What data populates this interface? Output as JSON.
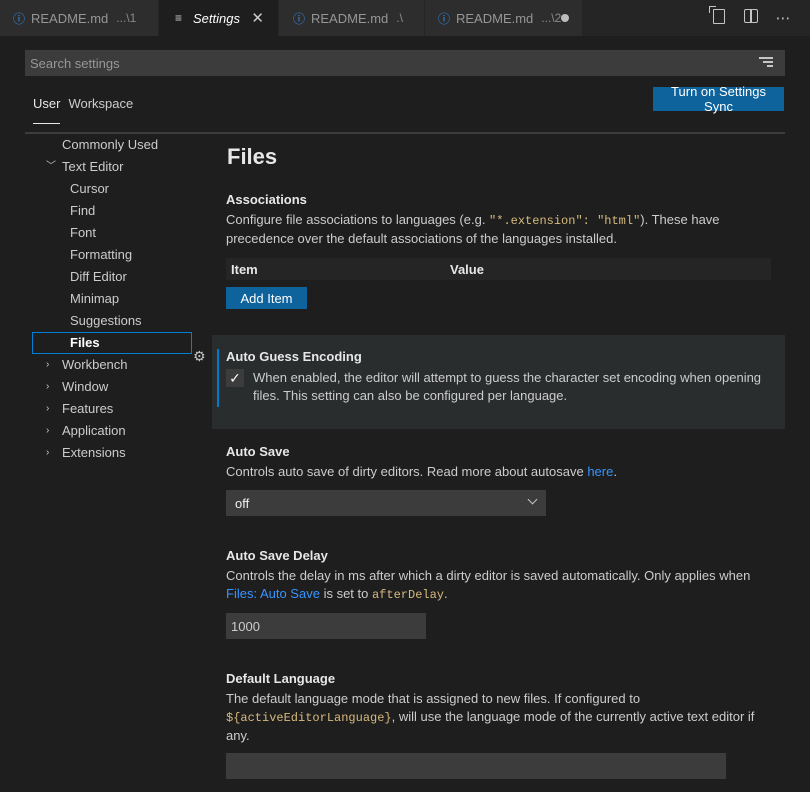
{
  "tabs": [
    {
      "label": "README.md",
      "description": "...\\1",
      "icon": "info-icon"
    },
    {
      "label": "Settings",
      "icon": "menu-icon",
      "close": "✕"
    },
    {
      "label": "README.md",
      "description": ".\\",
      "icon": "info-icon"
    },
    {
      "label": "README.md",
      "description": "...\\2",
      "icon": "info-icon",
      "dirty": true
    }
  ],
  "editor_actions": [
    "open-settings-json-icon",
    "split-editor-icon",
    "more-actions-icon"
  ],
  "search": {
    "placeholder": "Search settings"
  },
  "scope_tabs": [
    {
      "label": "User",
      "selected": true
    },
    {
      "label": "Workspace",
      "selected": false
    }
  ],
  "sync_button": "Turn on Settings Sync",
  "toc": [
    {
      "label": "Commonly Used"
    },
    {
      "label": "Text Editor",
      "expanded": true
    },
    {
      "label": "Cursor"
    },
    {
      "label": "Find"
    },
    {
      "label": "Font"
    },
    {
      "label": "Formatting"
    },
    {
      "label": "Diff Editor"
    },
    {
      "label": "Minimap"
    },
    {
      "label": "Suggestions"
    },
    {
      "label": "Files",
      "selected": true
    },
    {
      "label": "Workbench",
      "expanded": false
    },
    {
      "label": "Window",
      "expanded": false
    },
    {
      "label": "Features",
      "expanded": false
    },
    {
      "label": "Application",
      "expanded": false
    },
    {
      "label": "Extensions",
      "expanded": false
    }
  ],
  "main": {
    "page_title": "Files",
    "associations": {
      "title": "Associations",
      "desc_before": "Configure file associations to languages (e.g. ",
      "desc_code": "\"*.extension\": \"html\"",
      "desc_after": "). These have",
      "desc_line2": "precedence over the default associations of the languages installed.",
      "col_item": "Item",
      "col_value": "Value",
      "add_button": "Add Item"
    },
    "auto_guess": {
      "title": "Auto Guess Encoding",
      "checked": true,
      "desc_line1": "When enabled, the editor will attempt to guess the character set encoding when opening",
      "desc_line2": "files. This setting can also be configured per language."
    },
    "auto_save": {
      "title": "Auto Save",
      "desc_before": "Controls auto save of dirty editors. Read more about autosave ",
      "desc_link": "here",
      "desc_after": ".",
      "value": "off"
    },
    "auto_save_delay": {
      "title": "Auto Save Delay",
      "desc_line1": "Controls the delay in ms after which a dirty editor is saved automatically. Only applies when",
      "desc_link": "Files: Auto Save",
      "desc_mid": " is set to ",
      "desc_code": "afterDelay",
      "desc_end": ".",
      "value": "1000"
    },
    "default_language": {
      "title": "Default Language",
      "desc_line1": "The default language mode that is assigned to new files. If configured to",
      "desc_code": "${activeEditorLanguage}",
      "desc_after": ", will use the language mode of the currently active text editor if",
      "desc_line3": "any.",
      "value": ""
    }
  },
  "colors": {
    "accent": "#0e639c",
    "focus_border": "#007fd4",
    "link": "#3794ff",
    "code": "#d7ba7d"
  }
}
